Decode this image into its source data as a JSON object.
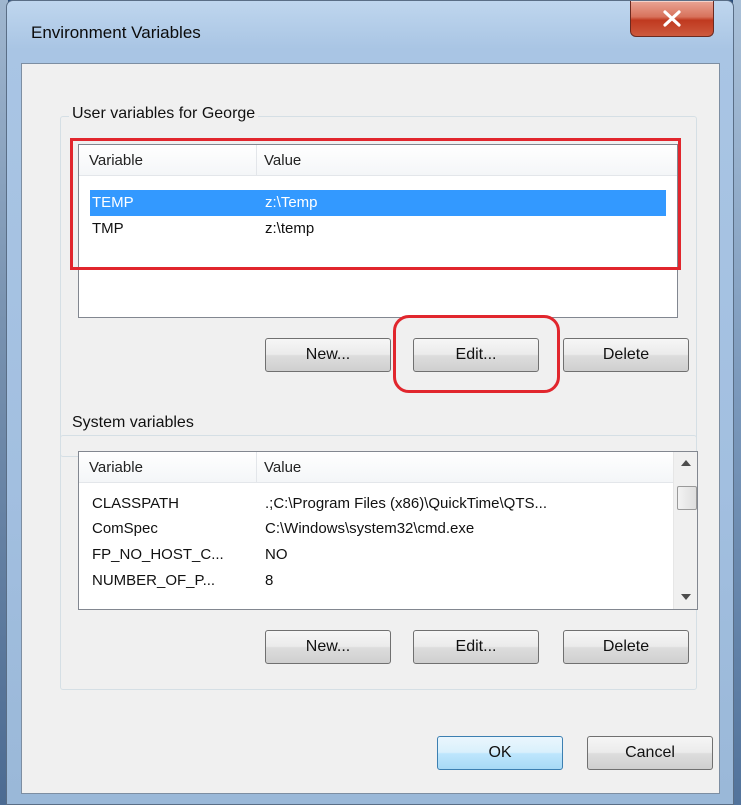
{
  "window": {
    "title": "Environment Variables"
  },
  "user_group": {
    "label": "User variables for George",
    "columns": [
      "Variable",
      "Value"
    ],
    "rows": [
      {
        "variable": "TEMP",
        "value": "z:\\Temp",
        "selected": true
      },
      {
        "variable": "TMP",
        "value": "z:\\temp",
        "selected": false
      }
    ],
    "buttons": {
      "new": "New...",
      "edit": "Edit...",
      "delete": "Delete"
    }
  },
  "system_group": {
    "label": "System variables",
    "columns": [
      "Variable",
      "Value"
    ],
    "rows": [
      {
        "variable": "CLASSPATH",
        "value": ".;C:\\Program Files (x86)\\QuickTime\\QTS..."
      },
      {
        "variable": "ComSpec",
        "value": "C:\\Windows\\system32\\cmd.exe"
      },
      {
        "variable": "FP_NO_HOST_C...",
        "value": "NO"
      },
      {
        "variable": "NUMBER_OF_P...",
        "value": "8"
      }
    ],
    "buttons": {
      "new": "New...",
      "edit": "Edit...",
      "delete": "Delete"
    }
  },
  "dialog_buttons": {
    "ok": "OK",
    "cancel": "Cancel"
  },
  "colors": {
    "selection": "#3399ff",
    "annotation": "#e1262d",
    "close_button": "#c0391f"
  },
  "icons": {
    "close": "close-icon",
    "scroll_up": "scroll-up-arrow-icon",
    "scroll_down": "scroll-down-arrow-icon"
  }
}
